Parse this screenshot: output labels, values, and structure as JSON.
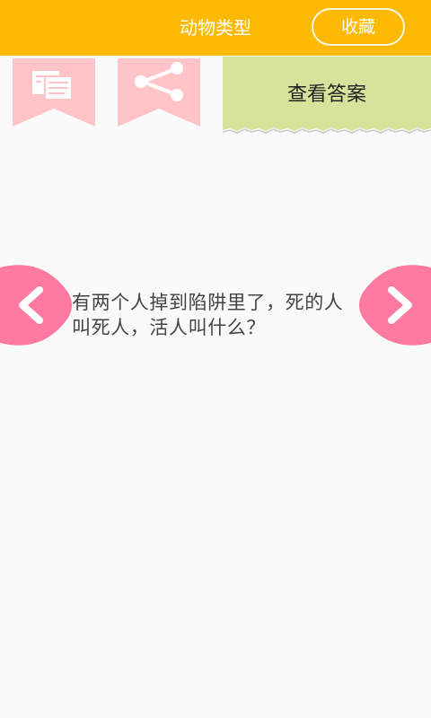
{
  "header": {
    "title": "动物类型",
    "favorite_label": "收藏",
    "background": "#fdb904"
  },
  "toolbar": {
    "copy_icon": "copy-icon",
    "share_icon": "share-icon",
    "ribbon_color": "#ffc4c8"
  },
  "answer": {
    "label": "查看答案",
    "background": "#d7e39a"
  },
  "navigation": {
    "prev_icon": "chevron-left-icon",
    "next_icon": "chevron-right-icon",
    "accent": "#ff7aa3"
  },
  "question": {
    "text": "有两个人掉到陷阱里了，死的人叫死人，活人叫什么？"
  }
}
